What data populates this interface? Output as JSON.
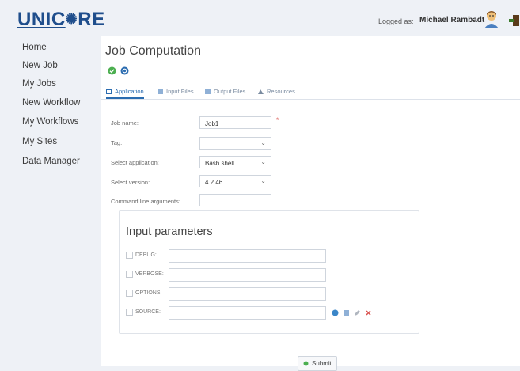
{
  "header": {
    "logo_left": "UNIC",
    "logo_right": "RE",
    "logged_as_label": "Logged as:",
    "username": "Michael Rambadt"
  },
  "sidebar": {
    "items": [
      {
        "label": "Home"
      },
      {
        "label": "New Job"
      },
      {
        "label": "My Jobs"
      },
      {
        "label": "New Workflow"
      },
      {
        "label": "My Workflows"
      },
      {
        "label": "My Sites"
      },
      {
        "label": "Data Manager"
      }
    ]
  },
  "main": {
    "title": "Job Computation",
    "tabs": [
      {
        "label": "Application",
        "icon": "application-icon"
      },
      {
        "label": "Input Files",
        "icon": "input-files-icon"
      },
      {
        "label": "Output Files",
        "icon": "output-files-icon"
      },
      {
        "label": "Resources",
        "icon": "resources-icon"
      }
    ],
    "form": {
      "job_name_label": "Job name:",
      "job_name_value": "Job1",
      "required_mark": "*",
      "tag_label": "Tag:",
      "tag_value": "",
      "application_label": "Select application:",
      "application_value": "Bash shell",
      "version_label": "Select version:",
      "version_value": "4.2.46",
      "args_label": "Command line arguments:",
      "args_value": ""
    },
    "input_parameters": {
      "title": "Input parameters",
      "params": [
        {
          "label": "DEBUG:",
          "value": ""
        },
        {
          "label": "VERBOSE:",
          "value": ""
        },
        {
          "label": "OPTIONS:",
          "value": ""
        },
        {
          "label": "SOURCE:",
          "value": ""
        }
      ]
    },
    "submit_label": "Submit"
  },
  "colors": {
    "background": "#eef1f6",
    "brand": "#1f4e8c",
    "accent": "#2b6cb0",
    "success": "#4caf50",
    "danger": "#d9534f"
  }
}
